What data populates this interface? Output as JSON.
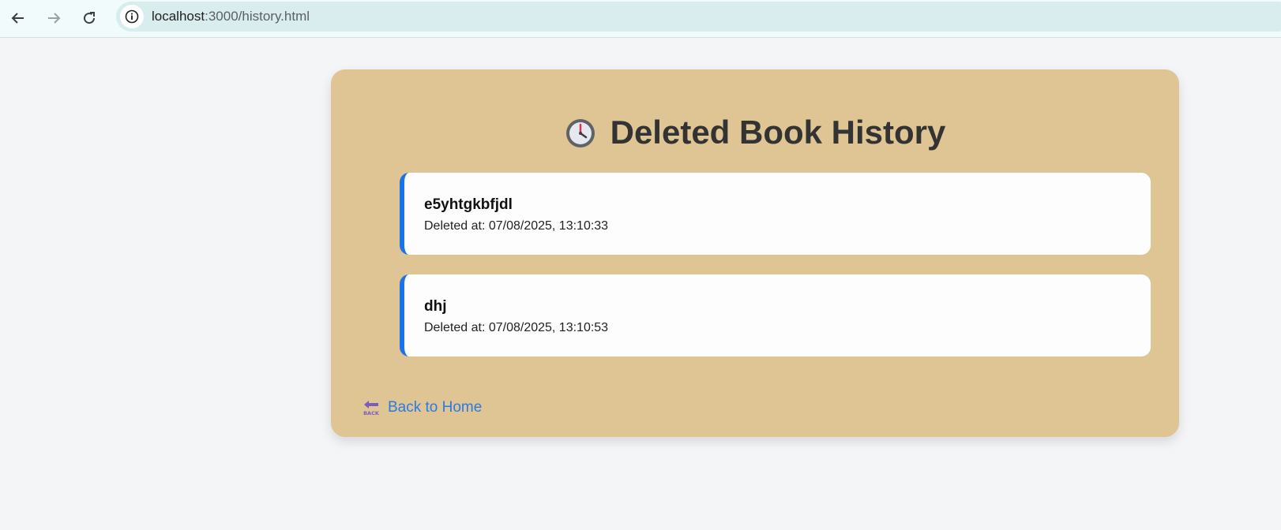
{
  "browser": {
    "url_host": "localhost",
    "url_path": ":3000/history.html"
  },
  "page": {
    "title": "Deleted Book History",
    "title_icon": "clock-icon",
    "back_link": "Back to Home",
    "back_icon": "back-arrow-icon"
  },
  "history": [
    {
      "title": "e5yhtgkbfjdl",
      "deleted_at": "Deleted at: 07/08/2025, 13:10:33"
    },
    {
      "title": "dhj",
      "deleted_at": "Deleted at: 07/08/2025, 13:10:53"
    }
  ],
  "colors": {
    "card_background": "#dfc494",
    "accent": "#1a73e8",
    "link": "#2b7be4"
  }
}
